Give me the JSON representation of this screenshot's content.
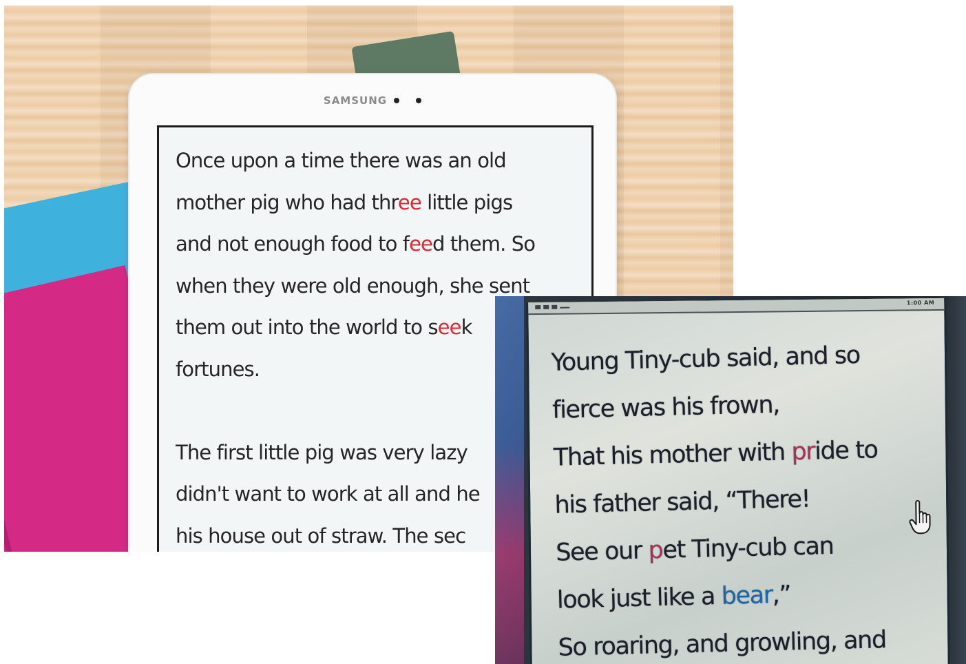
{
  "photo_tablet": {
    "brand": "SAMSUNG",
    "story_paragraph_1": [
      [
        {
          "t": "Once upon a time there was an old",
          "hl": ""
        }
      ],
      [
        {
          "t": "mother pig who had thr",
          "hl": ""
        },
        {
          "t": "ee",
          "hl": "red"
        },
        {
          "t": " little pigs",
          "hl": ""
        }
      ],
      [
        {
          "t": "and not enough food to f",
          "hl": ""
        },
        {
          "t": "ee",
          "hl": "red"
        },
        {
          "t": "d them. So",
          "hl": ""
        }
      ],
      [
        {
          "t": "when they were old enough, she sent",
          "hl": ""
        }
      ],
      [
        {
          "t": "them out into the world to s",
          "hl": ""
        },
        {
          "t": "ee",
          "hl": "red"
        },
        {
          "t": "k",
          "hl": ""
        }
      ],
      [
        {
          "t": "fortunes.",
          "hl": ""
        }
      ]
    ],
    "story_paragraph_2": [
      [
        {
          "t": "The first little pig was very lazy",
          "hl": ""
        }
      ],
      [
        {
          "t": "didn't want to work at all and he",
          "hl": ""
        }
      ],
      [
        {
          "t": "his house out of straw. The sec",
          "hl": ""
        }
      ]
    ],
    "highlight_color": "#e0262f"
  },
  "photo_monitor": {
    "status_text": "1:00 AM",
    "story_lines": [
      [
        {
          "t": "Young Tiny-cub said, and so",
          "hl": ""
        }
      ],
      [
        {
          "t": "fierce was his frown,",
          "hl": ""
        }
      ],
      [
        {
          "t": "That his mother with ",
          "hl": ""
        },
        {
          "t": "pr",
          "hl": "pink"
        },
        {
          "t": "ide to",
          "hl": ""
        }
      ],
      [
        {
          "t": "his father said, “There!",
          "hl": ""
        }
      ],
      [
        {
          "t": "See our ",
          "hl": ""
        },
        {
          "t": "p",
          "hl": "pink"
        },
        {
          "t": "et Tiny-cub can",
          "hl": ""
        }
      ],
      [
        {
          "t": "look just like a ",
          "hl": ""
        },
        {
          "t": "bear",
          "hl": "blue"
        },
        {
          "t": ",”",
          "hl": ""
        }
      ],
      [
        {
          "t": "So roaring, and growling, and",
          "hl": ""
        }
      ]
    ],
    "highlight_colors": {
      "blue": "#1f66a6",
      "pink": "#a8315a"
    },
    "cursor_icon": "hand-pointer-icon"
  }
}
